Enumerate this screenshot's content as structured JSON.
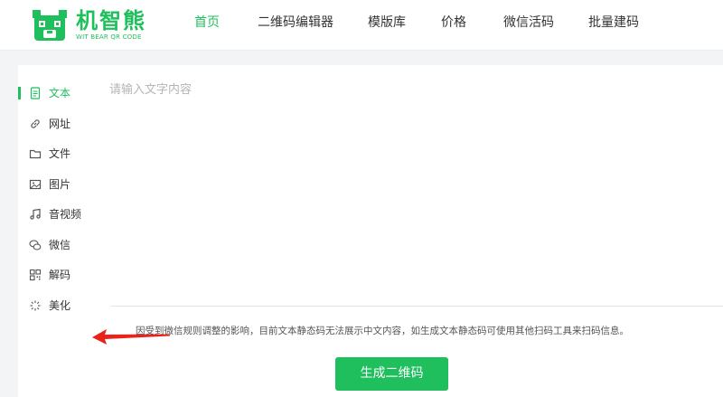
{
  "brand": {
    "name": "机智熊",
    "subtitle": "WIT BEAR QR CODE",
    "color": "#1fbf5d"
  },
  "nav": {
    "items": [
      {
        "label": "首页",
        "active": true
      },
      {
        "label": "二维码编辑器",
        "active": false
      },
      {
        "label": "模版库",
        "active": false
      },
      {
        "label": "价格",
        "active": false
      },
      {
        "label": "微信活码",
        "active": false
      },
      {
        "label": "批量建码",
        "active": false
      }
    ]
  },
  "sidebar": {
    "items": [
      {
        "label": "文本",
        "icon": "document-icon",
        "active": true
      },
      {
        "label": "网址",
        "icon": "link-icon",
        "active": false
      },
      {
        "label": "文件",
        "icon": "folder-icon",
        "active": false
      },
      {
        "label": "图片",
        "icon": "image-icon",
        "active": false
      },
      {
        "label": "音视频",
        "icon": "music-note-icon",
        "active": false
      },
      {
        "label": "微信",
        "icon": "wechat-icon",
        "active": false
      },
      {
        "label": "解码",
        "icon": "qr-scan-icon",
        "active": false
      },
      {
        "label": "美化",
        "icon": "sparkle-icon",
        "active": false
      }
    ]
  },
  "editor": {
    "placeholder": "请输入文字内容",
    "value": "",
    "notice": "因受到微信规则调整的影响，目前文本静态码无法展示中文内容，如生成文本静态码可使用其他扫码工具来扫码信息。",
    "generate_label": "生成二维码"
  },
  "annotation": {
    "arrow_color": "#e8231c"
  }
}
